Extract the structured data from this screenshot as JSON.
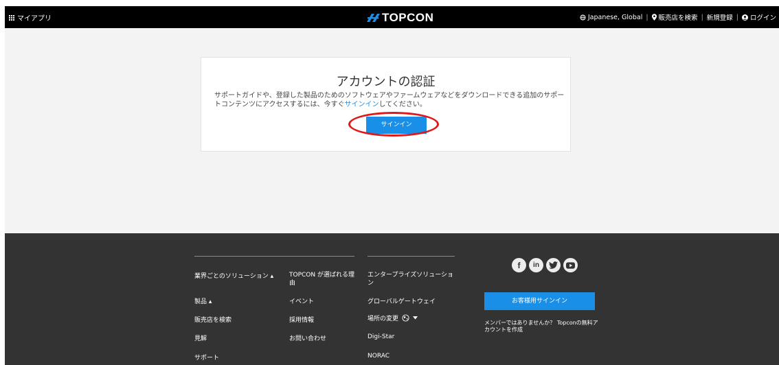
{
  "header": {
    "myapps_label": "マイアプリ",
    "logo_text": "TOPCON",
    "language_label": "Japanese, Global",
    "dealer_label": "販売店を検索",
    "register_label": "新規登録",
    "login_label": "ログイン",
    "separator": "|"
  },
  "card": {
    "title": "アカウントの認証",
    "text_before": "サポートガイドや、登録した製品のためのソフトウェアやファームウェアなどをダウンロードできる追加のサポートコンテンツにアクセスするには、今すぐ",
    "text_link": "サインイン",
    "text_after": "してください。",
    "signin_button": "サインイン"
  },
  "footer": {
    "col1": [
      "業界ごとのソリューション ▴",
      "製品 ▴",
      "販売店を検索",
      "見解",
      "サポート"
    ],
    "col2": [
      "TOPCON が選ばれる理由",
      "イベント",
      "採用情報",
      "お問い合わせ"
    ],
    "col3": [
      "エンタープライズソリューション",
      "グローバルゲートウェイ",
      "場所の変更",
      "Digi-Star",
      "NORAC"
    ],
    "social_icons": [
      "facebook-icon",
      "linkedin-icon",
      "twitter-icon",
      "youtube-icon"
    ],
    "customer_signin_button": "お客様用サインイン",
    "member_text": "メンバーではありませんか？ Topconの無料アカウントを作成"
  },
  "colors": {
    "accent": "#1a8fe8",
    "header_bg": "#000000",
    "footer_bg": "#333333",
    "annotation": "#e01818"
  }
}
